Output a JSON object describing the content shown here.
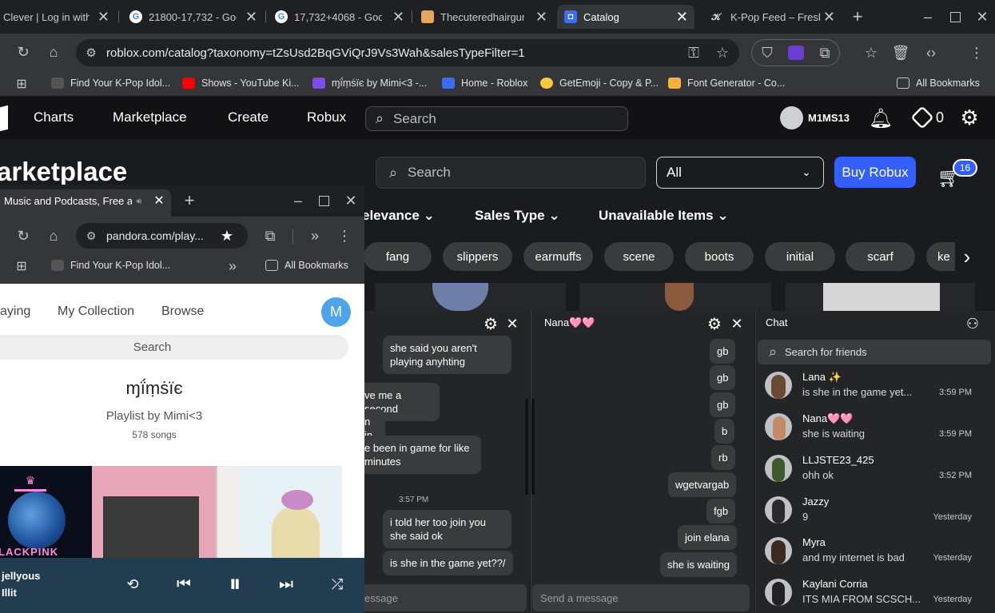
{
  "browser": {
    "tabs": [
      {
        "title": "Clever | Log in with",
        "icon": "clever-icon"
      },
      {
        "title": "21800-17,732 - Goo",
        "icon": "google-icon"
      },
      {
        "title": "17,732+4068 - Goo",
        "icon": "google-icon"
      },
      {
        "title": "Thecuteredhairgurl",
        "icon": "pinterest-icon"
      },
      {
        "title": "Catalog",
        "icon": "roblox-icon"
      },
      {
        "title": "K-Pop Feed – Fresh",
        "icon": "kpop-icon"
      }
    ],
    "url": "roblox.com/catalog?taxonomy=tZsUsd2BqGViQrJ9Vs3Wah&salesTypeFilter=1",
    "bookmarks": [
      "Find Your K-Pop Idol...",
      "Shows - YouTube Ki...",
      "ɱḯṃṡïє by Mimi<3 -...",
      "Home - Roblox",
      "GetEmoji - Copy & P...",
      "Font Generator - Co..."
    ],
    "all_bookmarks": "All Bookmarks"
  },
  "roblox": {
    "nav": [
      "Charts",
      "Marketplace",
      "Create",
      "Robux"
    ],
    "search_placeholder": "Search",
    "username": "M1MS13",
    "robux": "0",
    "page_title": "arketplace",
    "catalog_search": "Search",
    "category": "All",
    "buy_robux": "Buy Robux",
    "cart_count": "16",
    "filters": [
      "elevance",
      "Sales Type",
      "Unavailable Items"
    ],
    "chips": [
      "fang",
      "slippers",
      "earmuffs",
      "scene",
      "boots",
      "initial",
      "scarf",
      "ke"
    ]
  },
  "pandora": {
    "tab_title": "Music and Podcasts, Free a",
    "url": "pandora.com/play...",
    "bookmark": "Find Your K-Pop Idol...",
    "all_bookmarks": "All Bookmarks",
    "nav": [
      "aying",
      "My Collection",
      "Browse"
    ],
    "avatar_letter": "M",
    "search": "Search",
    "playlist_title": "ɱḯṃṡïє",
    "playlist_by": "Playlist by Mimi<3",
    "songs": "578 songs",
    "album1_text": "LACKPINK",
    "now_playing_title": "jellyous",
    "now_playing_artist": "Illit"
  },
  "chat_left": {
    "messages": [
      "she said you aren't playing anyhting",
      "ve me a second",
      "n in",
      "e been in game for like minutes",
      "i told her too join you she said ok",
      "is she in the game yet??/"
    ],
    "timestamp": "3:57 PM",
    "input_placeholder": "essage"
  },
  "chat_nana": {
    "title": "Nana🩷🩷",
    "messages": [
      "gb",
      "gb",
      "gb",
      "b",
      "rb",
      "wgetvargab",
      "fgb",
      "join elana",
      "she is waiting"
    ],
    "input_placeholder": "Send a message"
  },
  "chat_list": {
    "title": "Chat",
    "search": "Search for friends",
    "friends": [
      {
        "name": "Lana ✨",
        "msg": "is she in the game yet...",
        "time": "3:59 PM"
      },
      {
        "name": "Nana🩷🩷",
        "msg": "she is waiting",
        "time": "3:59 PM"
      },
      {
        "name": "LLJSTE23_425",
        "msg": "ohh ok",
        "time": "3:52 PM"
      },
      {
        "name": "Jazzy",
        "msg": "9",
        "time": "Yesterday"
      },
      {
        "name": "Myra",
        "msg": "and my internet is bad",
        "time": "Yesterday"
      },
      {
        "name": "Kaylani Corria",
        "msg": "ITS MIA FROM SCSCH...",
        "time": "Yesterday"
      }
    ]
  },
  "colors": {
    "accent_blue": "#335fff",
    "roblox_bg": "#191b1f",
    "pandora_player": "#213d4f",
    "pandora_avatar": "#4fa3e8"
  }
}
